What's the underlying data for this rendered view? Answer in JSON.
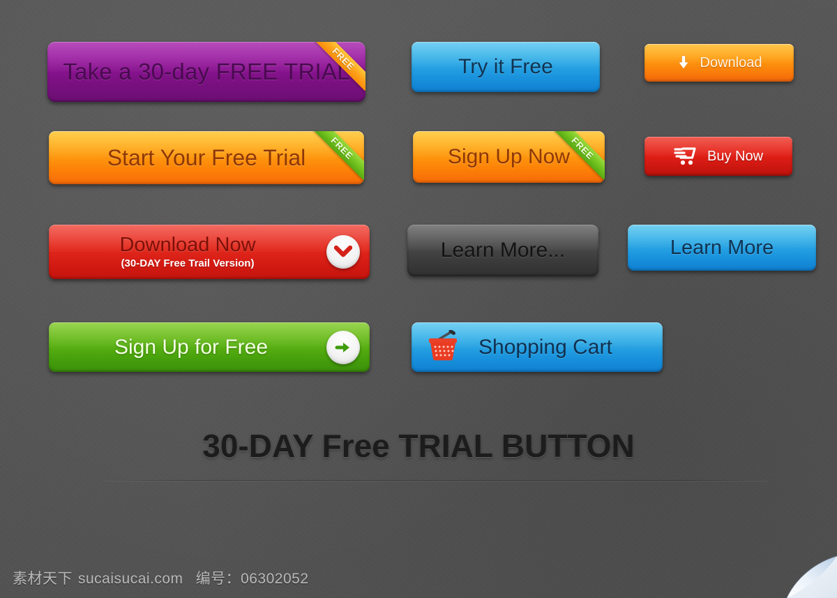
{
  "page": {
    "heading": "30-DAY Free TRIAL BUTTON",
    "background_color": "#565656"
  },
  "buttons": [
    {
      "id": "take-30-day-free-trial",
      "label": "Take a 30-day FREE TRIAL",
      "color": "#8f1396",
      "text_color": "#4a0a50",
      "ribbon": "FREE",
      "ribbon_color": "#ffa41b"
    },
    {
      "id": "try-it-free",
      "label": "Try it Free",
      "color": "#1f9ae0",
      "text_color": "#103352"
    },
    {
      "id": "download",
      "label": "Download",
      "color": "#fb8c0a",
      "text_color": "#fff4e2",
      "icon": "download-arrow-icon"
    },
    {
      "id": "start-your-free-trial",
      "label": "Start Your Free Trial",
      "color": "#fc8f0f",
      "text_color": "#8e3807",
      "ribbon": "FREE",
      "ribbon_color": "#74c420"
    },
    {
      "id": "sign-up-now",
      "label": "Sign Up Now",
      "color": "#fc8f0f",
      "text_color": "#8e3807",
      "ribbon": "FREE",
      "ribbon_color": "#74c420"
    },
    {
      "id": "buy-now",
      "label": "Buy Now",
      "color": "#d81c13",
      "text_color": "#ffffff",
      "icon": "shopping-cart-icon"
    },
    {
      "id": "download-now",
      "label": "Download Now",
      "sublabel": "(30-DAY Free Trail Version)",
      "color": "#de2418",
      "text_color": "#7d1008",
      "icon": "chevron-down-circle-icon"
    },
    {
      "id": "learn-more-ellipsis",
      "label": "Learn More...",
      "color": "#444444",
      "text_color": "#131313"
    },
    {
      "id": "learn-more",
      "label": "Learn More",
      "color": "#1f9ae0",
      "text_color": "#103352"
    },
    {
      "id": "sign-up-for-free",
      "label": "Sign Up for Free",
      "color": "#56ae12",
      "text_color": "#f4ffe4",
      "icon": "arrow-right-circle-icon"
    },
    {
      "id": "shopping-cart",
      "label": "Shopping Cart",
      "color": "#1f9ae0",
      "text_color": "#10304f",
      "icon": "shopping-basket-icon"
    }
  ],
  "footer": {
    "brand": "素材天下",
    "site": "sucaisucai.com",
    "code_label": "编号：",
    "code": "06302052"
  }
}
